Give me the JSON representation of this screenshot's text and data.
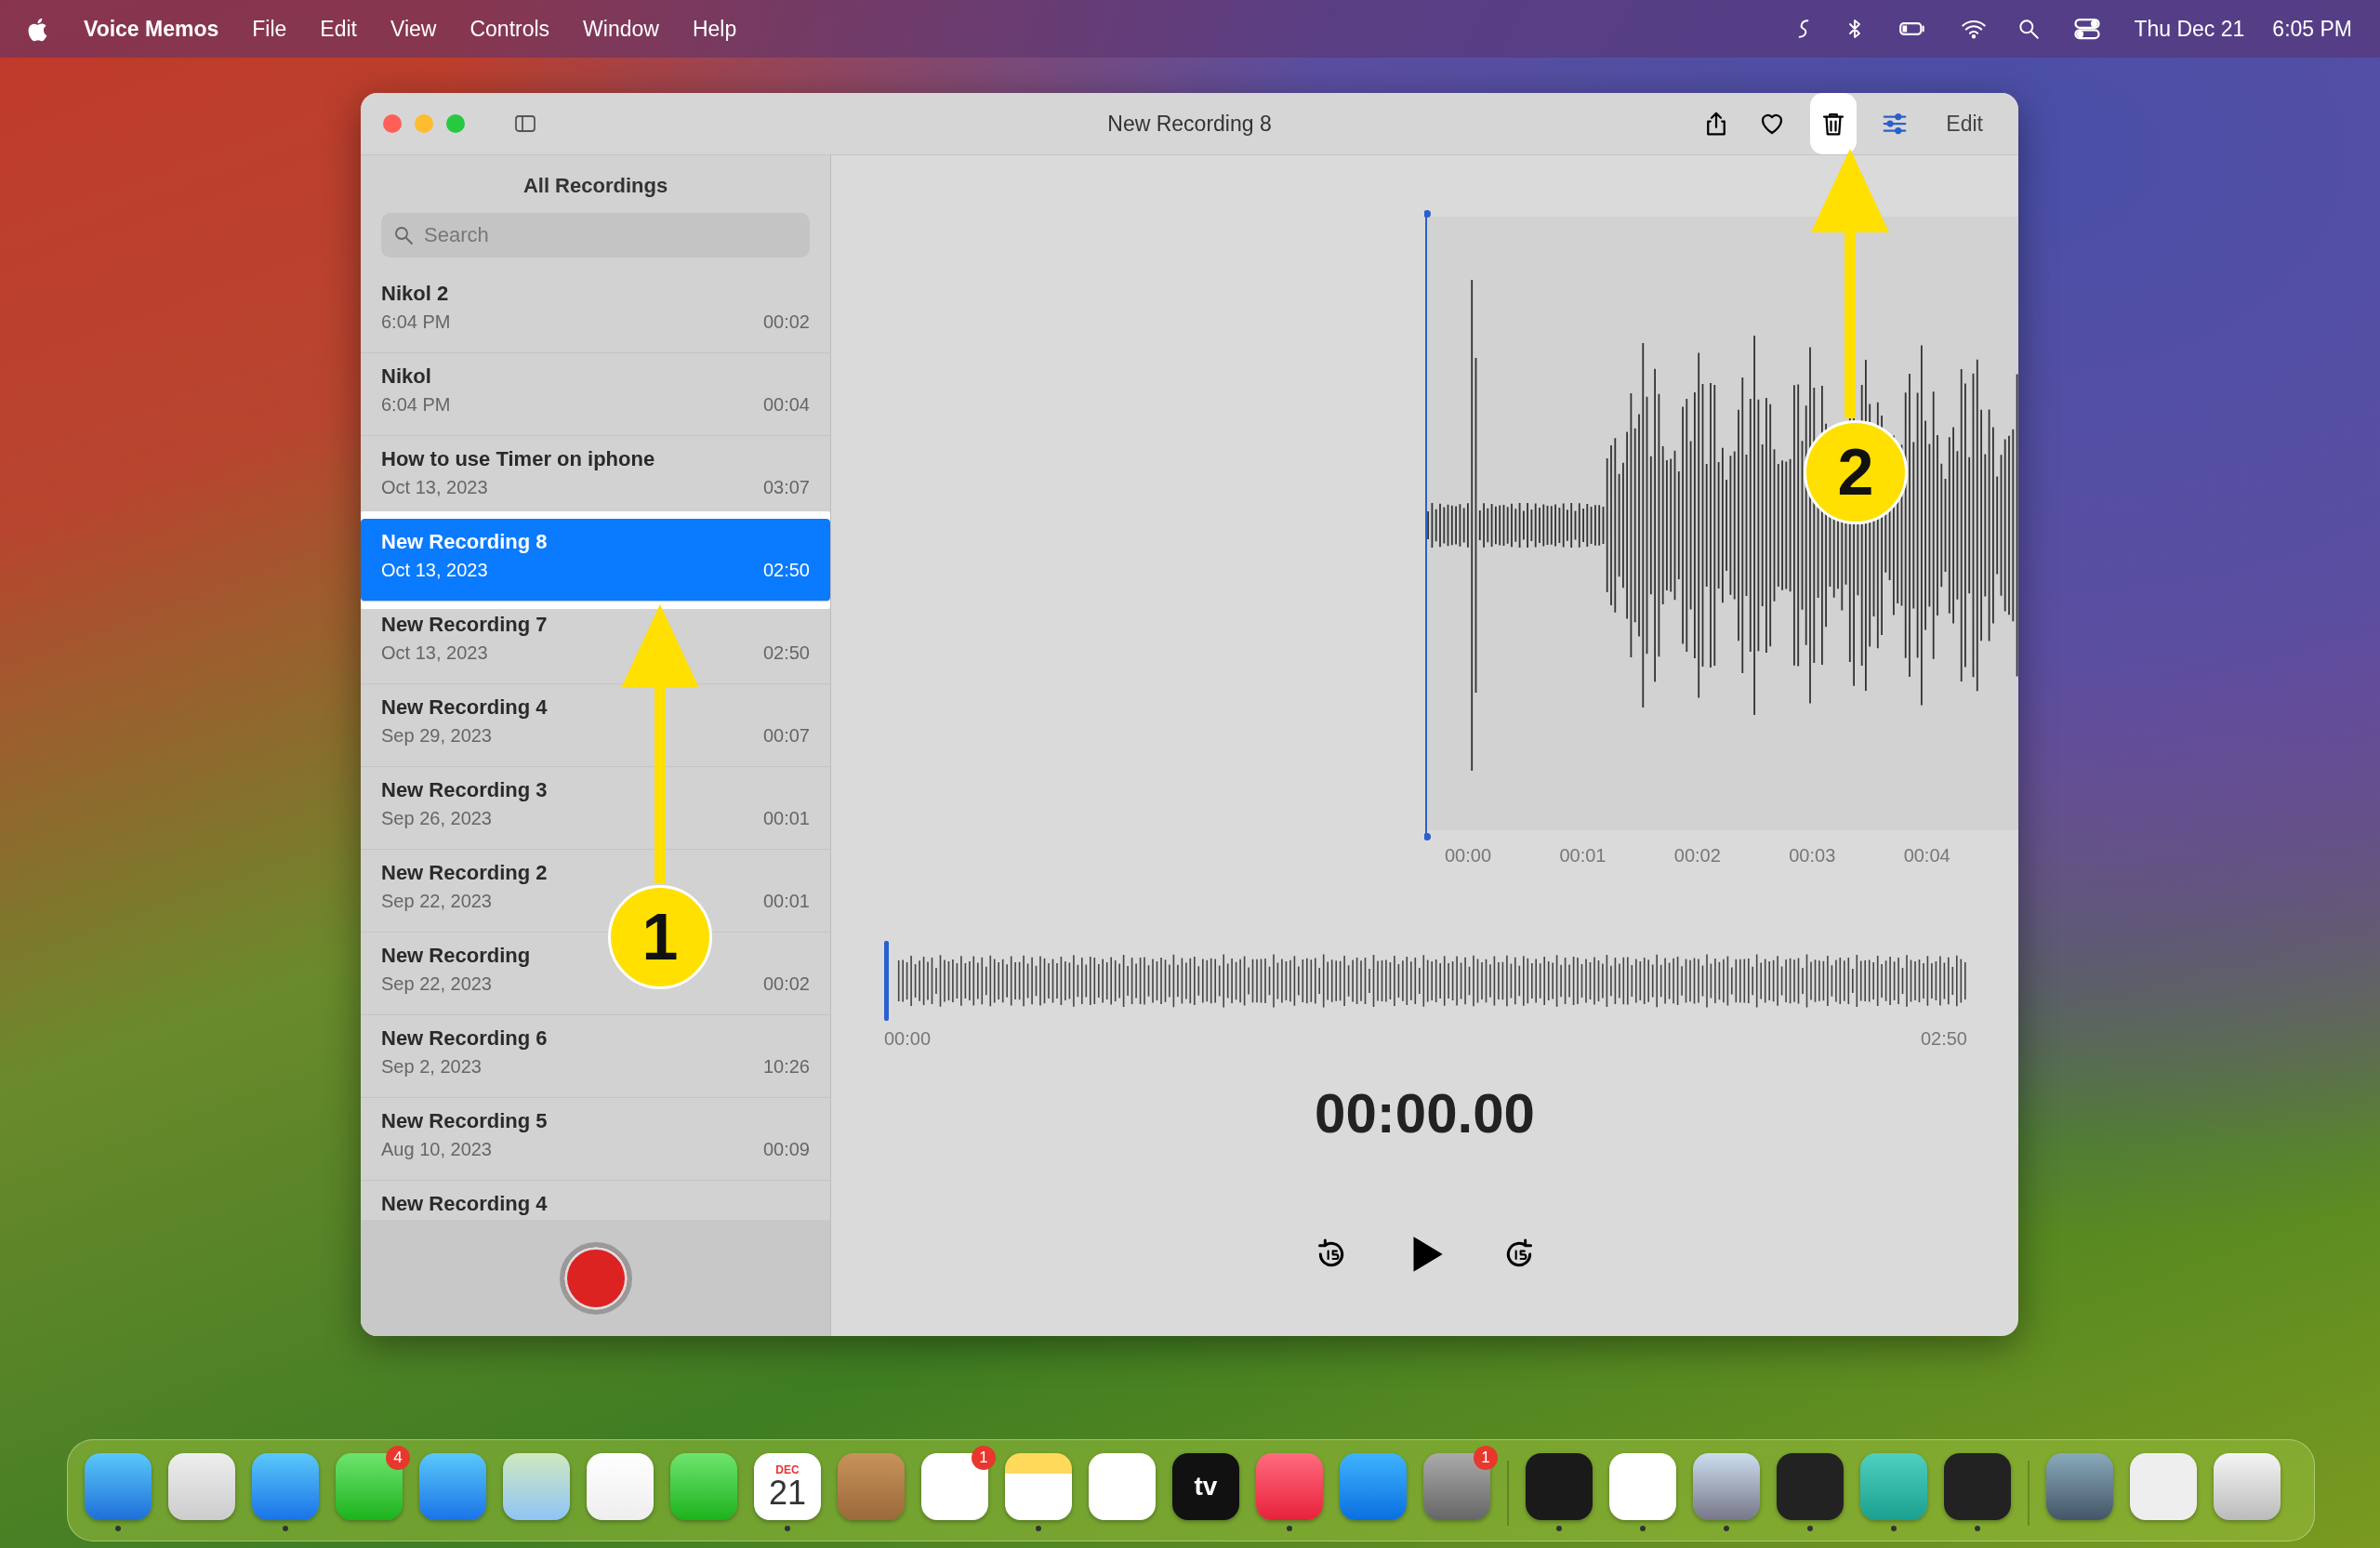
{
  "menu_bar": {
    "app_name": "Voice Memos",
    "menus": [
      "File",
      "Edit",
      "View",
      "Controls",
      "Window",
      "Help"
    ],
    "date": "Thu Dec 21",
    "time": "6:05 PM"
  },
  "window": {
    "title": "New Recording 8",
    "edit_button": "Edit",
    "trash_highlighted": true
  },
  "sidebar": {
    "heading": "All Recordings",
    "search": {
      "placeholder": "Search"
    },
    "recordings": [
      {
        "name": "Nikol 2",
        "date": "6:04 PM",
        "duration": "00:02",
        "selected": false
      },
      {
        "name": "Nikol",
        "date": "6:04 PM",
        "duration": "00:04",
        "selected": false
      },
      {
        "name": "How to use Timer on iphone",
        "date": "Oct 13, 2023",
        "duration": "03:07",
        "selected": false
      },
      {
        "name": "New Recording 8",
        "date": "Oct 13, 2023",
        "duration": "02:50",
        "selected": true
      },
      {
        "name": "New Recording 7",
        "date": "Oct 13, 2023",
        "duration": "02:50",
        "selected": false
      },
      {
        "name": "New Recording 4",
        "date": "Sep 29, 2023",
        "duration": "00:07",
        "selected": false
      },
      {
        "name": "New Recording 3",
        "date": "Sep 26, 2023",
        "duration": "00:01",
        "selected": false
      },
      {
        "name": "New Recording 2",
        "date": "Sep 22, 2023",
        "duration": "00:01",
        "selected": false
      },
      {
        "name": "New Recording",
        "date": "Sep 22, 2023",
        "duration": "00:02",
        "selected": false
      },
      {
        "name": "New Recording 6",
        "date": "Sep 2, 2023",
        "duration": "10:26",
        "selected": false
      },
      {
        "name": "New Recording 5",
        "date": "Aug 10, 2023",
        "duration": "00:09",
        "selected": false
      },
      {
        "name": "New Recording 4",
        "selected": false
      }
    ]
  },
  "player": {
    "timeline_labels": [
      "00:00",
      "00:01",
      "00:02",
      "00:03",
      "00:04"
    ],
    "overview_start": "00:00",
    "overview_end": "02:50",
    "elapsed": "00:00.00"
  },
  "dock": [
    {
      "running": true
    },
    {
      "running": false
    },
    {
      "running": true
    },
    {
      "running": false,
      "badge": "4"
    },
    {
      "running": false
    },
    {
      "running": false
    },
    {
      "running": false
    },
    {
      "running": false
    },
    {
      "running": true,
      "month": "DEC",
      "day": "21"
    },
    {
      "running": false
    },
    {
      "running": false,
      "badge": "1"
    },
    {
      "running": true
    },
    {
      "running": false
    },
    {
      "running": false,
      "label": "tv"
    },
    {
      "running": true
    },
    {
      "running": false
    },
    {
      "running": false,
      "badge": "1"
    },
    {
      "running": true
    },
    {
      "running": true
    },
    {
      "running": true
    },
    {
      "running": true
    },
    {
      "running": true
    },
    {
      "running": true
    },
    {
      "running": false
    },
    {
      "running": false
    },
    {
      "running": false
    }
  ],
  "annotations": [
    {
      "label": "1"
    },
    {
      "label": "2"
    }
  ]
}
